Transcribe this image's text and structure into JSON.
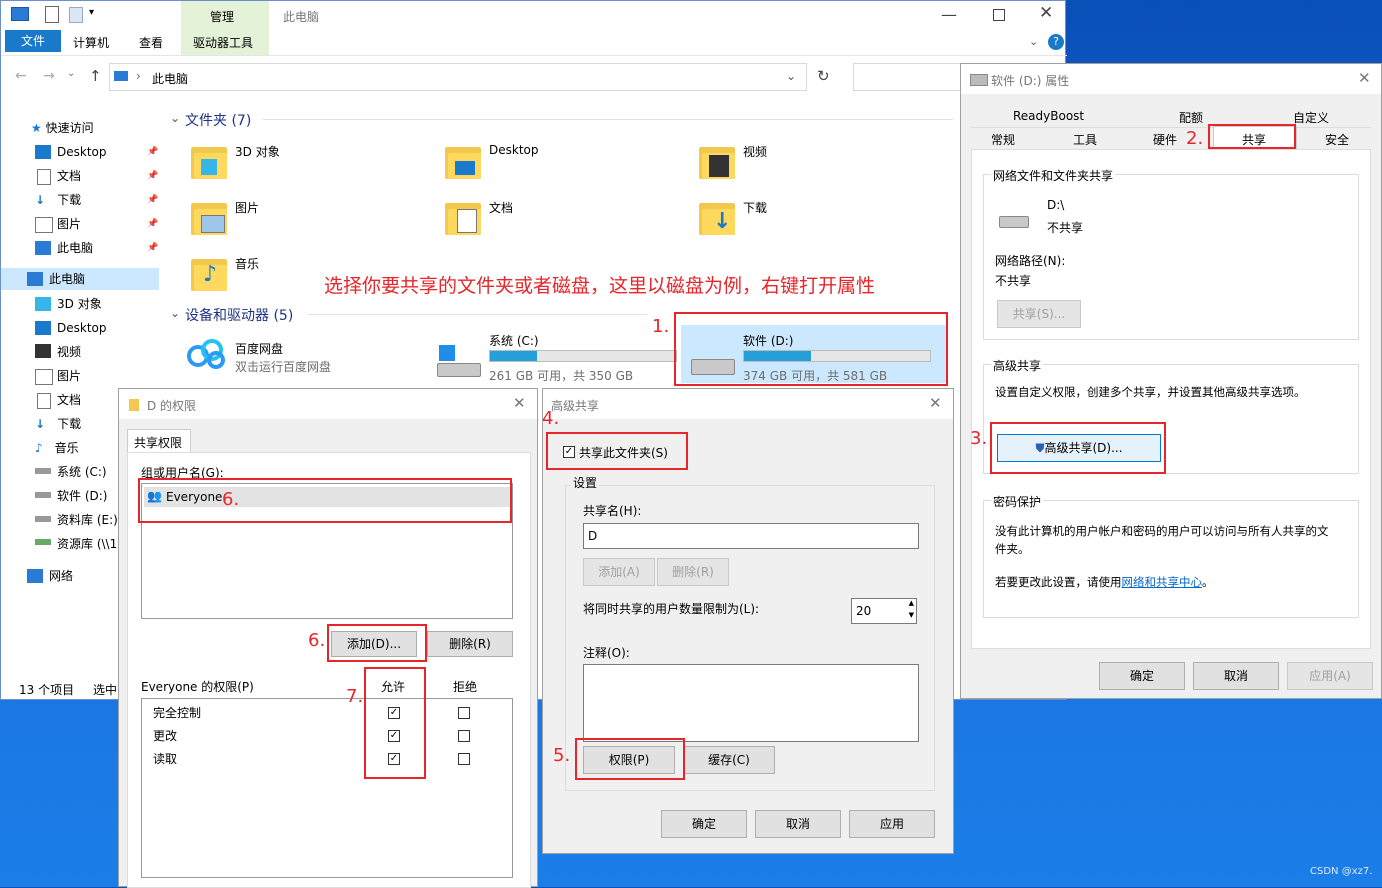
{
  "explorer": {
    "ribbon": {
      "tab_manage": "管理",
      "window_title": "此电脑",
      "tab_file": "文件",
      "tab_computer": "计算机",
      "tab_view": "查看",
      "tab_drive_tools": "驱动器工具"
    },
    "address": "此电脑",
    "status_count": "13 个项目",
    "status_selected": "选中",
    "nav": {
      "quick_access": "快速访问",
      "desktop": "Desktop",
      "docs": "文档",
      "downloads": "下载",
      "pictures": "图片",
      "this_pc": "此电脑",
      "this_pc_selected": "此电脑",
      "obj3d": "3D 对象",
      "desktop2": "Desktop",
      "videos": "视频",
      "pictures2": "图片",
      "docs2": "文档",
      "downloads2": "下载",
      "music": "音乐",
      "drive_c": "系统 (C:)",
      "drive_d": "软件 (D:)",
      "drive_e": "资料库 (E:)",
      "drive_net": "资源库 (\\\\1",
      "network": "网络"
    },
    "folders_header": "文件夹 (7)",
    "folders": {
      "f1": "3D 对象",
      "f2": "Desktop",
      "f3": "视频",
      "f4": "图片",
      "f5": "文档",
      "f6": "下载",
      "f7": "音乐"
    },
    "devices_header": "设备和驱动器 (5)",
    "baidu_name": "百度网盘",
    "baidu_sub": "双击运行百度网盘",
    "drive_c_name": "系统 (C:)",
    "drive_c_usage": "261 GB 可用，共 350 GB",
    "drive_c_used_fraction": 0.25,
    "drive_d_name": "软件 (D:)",
    "drive_d_usage": "374 GB 可用，共 581 GB",
    "drive_d_used_fraction": 0.36
  },
  "annotation": {
    "instruction": "选择你要共享的文件夹或者磁盘，这里以磁盘为例，右键打开属性",
    "n1": "1.",
    "n2": "2.",
    "n3": "3.",
    "n4": "4.",
    "n5": "5.",
    "n6a": "6.",
    "n6b": "6.",
    "n7": "7."
  },
  "props": {
    "title": "软件 (D:) 属性",
    "tabs": {
      "readyboost": "ReadyBoost",
      "quota": "配额",
      "custom": "自定义",
      "general": "常规",
      "tools": "工具",
      "hardware": "硬件",
      "sharing": "共享",
      "security": "安全"
    },
    "net_group": "网络文件和文件夹共享",
    "path": "D:\\",
    "not_shared": "不共享",
    "net_path_label": "网络路径(N):",
    "net_path_value": "不共享",
    "share_btn": "共享(S)...",
    "adv_group": "高级共享",
    "adv_desc": "设置自定义权限，创建多个共享，并设置其他高级共享选项。",
    "adv_btn": "高级共享(D)...",
    "pwd_group": "密码保护",
    "pwd_desc": "没有此计算机的用户帐户和密码的用户可以访问与所有人共享的文件夹。",
    "pwd_change_pre": "若要更改此设置，请使用",
    "pwd_link": "网络和共享中心",
    "pwd_change_post": "。",
    "ok": "确定",
    "cancel": "取消",
    "apply": "应用(A)"
  },
  "adv": {
    "title": "高级共享",
    "share_check": "共享此文件夹(S)",
    "settings": "设置",
    "share_name_label": "共享名(H):",
    "share_name": "D",
    "add": "添加(A)",
    "remove": "删除(R)",
    "limit_label": "将同时共享的用户数量限制为(L):",
    "limit_value": "20",
    "comment_label": "注释(O):",
    "perm_btn": "权限(P)",
    "cache_btn": "缓存(C)",
    "ok": "确定",
    "cancel": "取消",
    "apply": "应用"
  },
  "perm": {
    "title": "D 的权限",
    "tab": "共享权限",
    "group_label": "组或用户名(G):",
    "user": "Everyone",
    "add": "添加(D)...",
    "remove": "删除(R)",
    "perm_label": "Everyone 的权限(P)",
    "allow": "允许",
    "deny": "拒绝",
    "rows": [
      {
        "name": "完全控制",
        "allow": true,
        "deny": false
      },
      {
        "name": "更改",
        "allow": true,
        "deny": false
      },
      {
        "name": "读取",
        "allow": true,
        "deny": false
      }
    ]
  },
  "watermark": "CSDN @xz7."
}
